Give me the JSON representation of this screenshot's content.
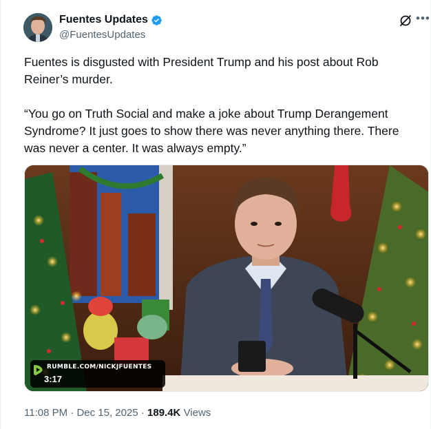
{
  "author": {
    "display_name": "Fuentes Updates",
    "handle": "@FuentesUpdates",
    "verified": true
  },
  "icons": {
    "verified": "verified-badge-icon",
    "grok": "grok-icon",
    "more": "more-options-icon",
    "media_source": "rumble-logo-icon"
  },
  "tweet": {
    "text": "Fuentes is disgusted with President Trump and his post about Rob Reiner’s murder.\n\n“You go on Truth Social and make a joke about Trump Derangement Syndrome? It just goes to show there was never anything there. There was never a center. It was always empty.”"
  },
  "media": {
    "watermark": "RUMBLE.COM/NICKJFUENTES",
    "duration": "3:17"
  },
  "meta": {
    "time": "11:08 PM",
    "date": "Dec 15, 2025",
    "views_count": "189.4K",
    "views_label": "Views"
  },
  "colors": {
    "accent": "#1d9bf0",
    "secondary_text": "#536471",
    "primary_text": "#0f1419"
  }
}
